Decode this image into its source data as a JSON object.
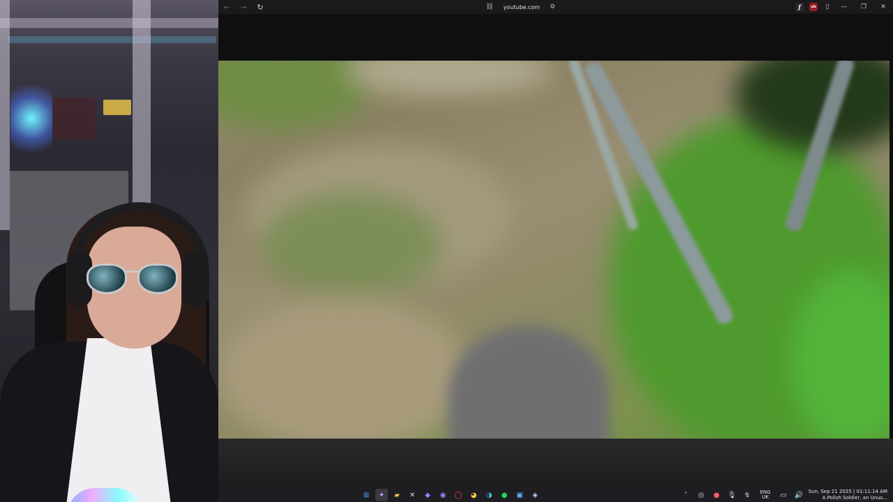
{
  "browser": {
    "url": "youtube.com",
    "nav": {
      "back": "←",
      "forward": "→",
      "reload": "↻"
    },
    "extensions": {
      "f_label": "f",
      "ublock_label": "ub"
    },
    "window_controls": {
      "minimize": "—",
      "maximize": "❐",
      "close": "✕"
    }
  },
  "taskbar": {
    "apps": [
      "windows-start",
      "app-selected",
      "file-explorer",
      "xbox",
      "firefox",
      "discord",
      "opera-gx",
      "chrome",
      "edge",
      "spotify",
      "image-app",
      "steam"
    ],
    "language_line1": "ENG",
    "language_line2": "UK",
    "clock_line1": "Sun, Sep 21 2025 | 01:11:14 AM",
    "clock_line2": "A Polish Soldier, an Unus..."
  },
  "colors": {
    "taskbar_bg": "#1e1e22",
    "titlebar_bg": "#1a1a1c",
    "ublock_red": "#9b1b23"
  }
}
